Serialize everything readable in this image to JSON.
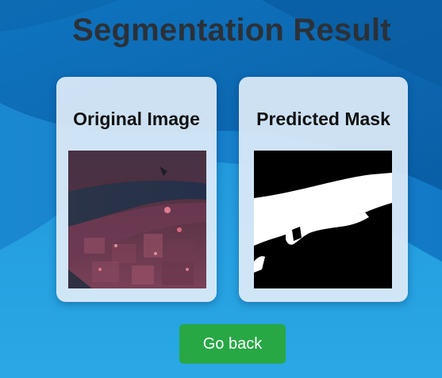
{
  "page": {
    "title": "Segmentation Result"
  },
  "cards": {
    "original": {
      "heading": "Original Image"
    },
    "mask": {
      "heading": "Predicted Mask"
    }
  },
  "actions": {
    "go_back_label": "Go back"
  },
  "colors": {
    "background_light": "#29a6e4",
    "background_dark": "#0a67b1",
    "title": "#2b3138",
    "card": "#deecf8",
    "button": "#28a745",
    "button_text": "#ffffff"
  }
}
